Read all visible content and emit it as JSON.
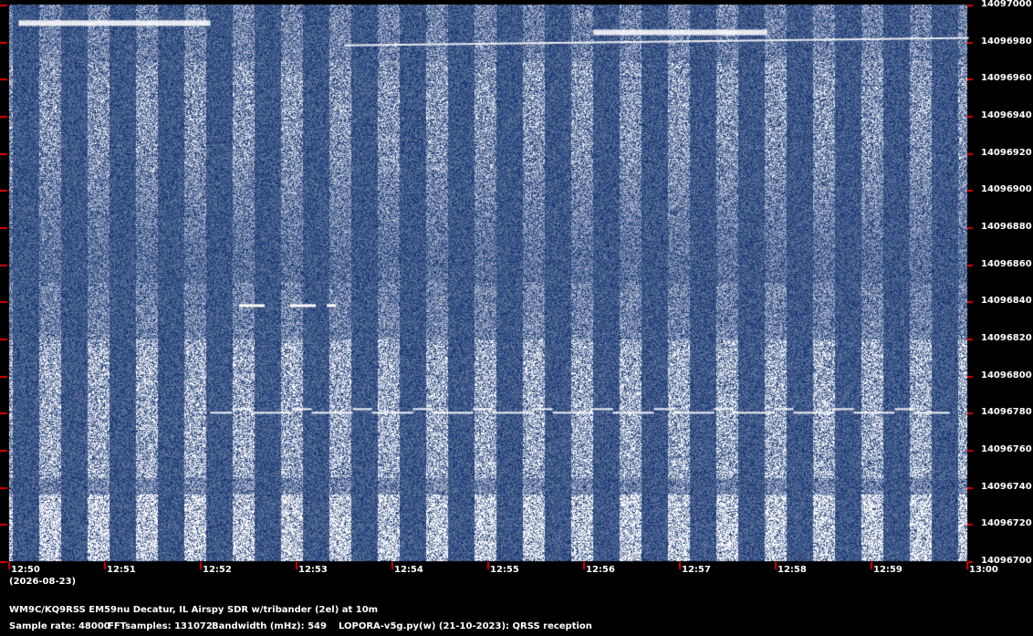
{
  "chart_data": {
    "type": "heatmap",
    "title": "",
    "x_ticks": [
      "12:50",
      "12:51",
      "12:52",
      "12:53",
      "12:54",
      "12:55",
      "12:56",
      "12:57",
      "12:58",
      "12:59",
      "13:00"
    ],
    "x_date": "(2026-08-23)",
    "y_ticks": [
      "14096700",
      "14096720",
      "14096740",
      "14096760",
      "14096780",
      "14096800",
      "14096820",
      "14096840",
      "14096860",
      "14096880",
      "14096900",
      "14096920",
      "14096940",
      "14096960",
      "14096980",
      "14097000"
    ],
    "xlim": [
      "12:50",
      "13:00"
    ],
    "ylim": [
      14096700,
      14097000
    ],
    "background_color": "#0a2a66",
    "signal_color": "#ffffff",
    "tick_color": "#e00000",
    "signals": [
      {
        "kind": "qrss-trace",
        "freq_hz": 14096780,
        "start": "12:52.1",
        "end": "12:59.8"
      },
      {
        "kind": "short-trace",
        "freq_hz": 14096838,
        "start": "12:52.4",
        "end": "12:53.4"
      },
      {
        "kind": "drifting-trace",
        "freq_hz_start": 14096978,
        "freq_hz_end": 14096982,
        "start": "12:53.5",
        "end": "13:00"
      },
      {
        "kind": "trace",
        "freq_hz": 14096985,
        "start": "12:56.1",
        "end": "12:57.9"
      },
      {
        "kind": "trace",
        "freq_hz": 14096990,
        "start": "12:50.1",
        "end": "12:52.1"
      }
    ]
  },
  "footer": {
    "line1": "WM9C/KQ9RSS EM59nu Decatur, IL  Airspy SDR w/tribander (2el) at 10m",
    "sample_rate": "Sample rate: 48000",
    "fft_samples": "FFTsamples: 131072",
    "bandwidth": "Bandwidth (mHz): 549",
    "software": "LOPORA-v5g.py(w) (21-10-2023): QRSS reception"
  }
}
